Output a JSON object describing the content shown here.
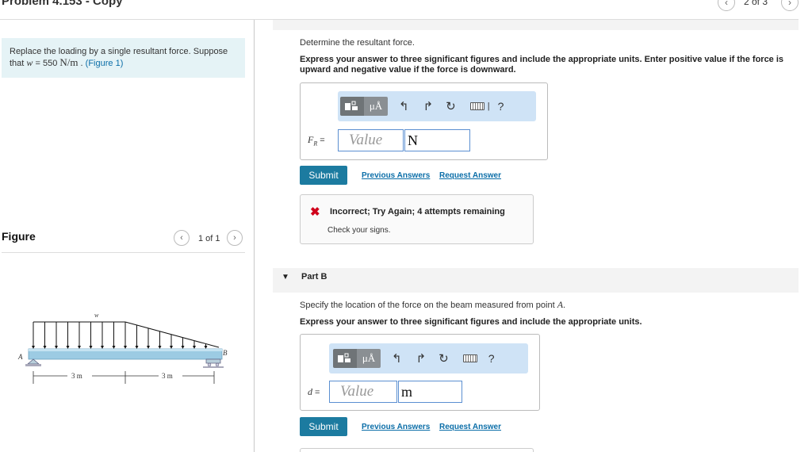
{
  "header": {
    "title": "Problem 4.153 - Copy",
    "pager": "2 of 3"
  },
  "problem": {
    "text_before": "Replace the loading by a single resultant force. Suppose that ",
    "var": "w",
    "equals": " = 550 ",
    "unit": "N/m",
    "text_after": " . ",
    "figure_link": "(Figure 1)"
  },
  "figure_panel": {
    "heading": "Figure",
    "pager": "1 of 1",
    "labels": {
      "w": "w",
      "a": "A",
      "b": "B",
      "dim1": "3 m",
      "dim2": "3 m"
    }
  },
  "partA": {
    "prompt": "Determine the resultant force.",
    "instruction": "Express your answer to three significant figures and include the appropriate units. Enter positive value if the force is upward and negative value if the force is downward.",
    "label_var": "F",
    "label_sub": "R",
    "label_eq": " =",
    "value_placeholder": "Value",
    "unit_value": "N",
    "submit_label": "Submit",
    "previous_answers": "Previous Answers",
    "request_answer": "Request Answer",
    "feedback_title": "Incorrect; Try Again; 4 attempts remaining",
    "feedback_hint": "Check your signs.",
    "help": "?"
  },
  "partB": {
    "title": "Part B",
    "prompt_before": "Specify the location of the force on the beam measured from point ",
    "prompt_point": "A",
    "prompt_after": ".",
    "instruction": "Express your answer to three significant figures and include the appropriate units.",
    "label_var": "d",
    "label_eq": " =",
    "value_placeholder": "Value",
    "unit_value": "m",
    "submit_label": "Submit",
    "previous_answers": "Previous Answers",
    "request_answer": "Request Answer",
    "help": "?"
  },
  "toolbar_mu": "μÅ",
  "colors": {
    "accent": "#1c7ba0",
    "link": "#0b6ea8",
    "toolbar_bg": "#cfe3f6",
    "problem_bg": "#e5f3f6",
    "error": "#d0021b"
  }
}
